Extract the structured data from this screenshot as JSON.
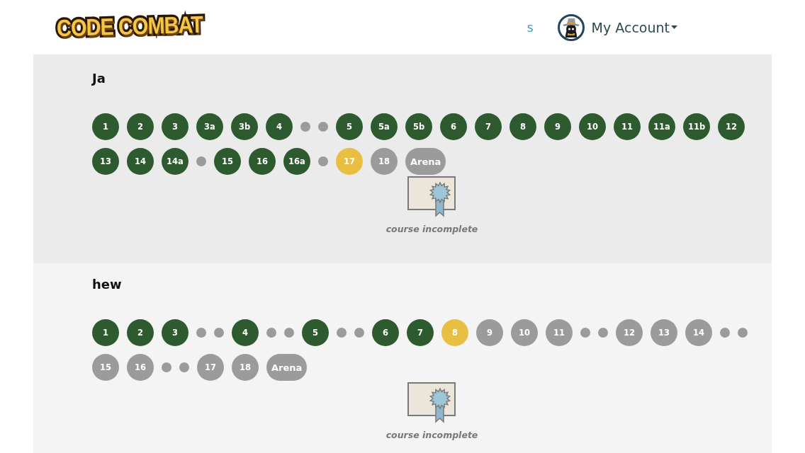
{
  "header": {
    "logo": "CODE COMBAT",
    "nav_links": [
      "s"
    ],
    "account": {
      "label": "My Account"
    }
  },
  "students": [
    {
      "name": "Ja",
      "levels": [
        {
          "kind": "level",
          "label": "1",
          "color": "#2e5a30"
        },
        {
          "kind": "level",
          "label": "2",
          "color": "#2e5a30"
        },
        {
          "kind": "level",
          "label": "3",
          "color": "#2e5a30"
        },
        {
          "kind": "level",
          "label": "3a",
          "color": "#2e5a30"
        },
        {
          "kind": "level",
          "label": "3b",
          "color": "#2e5a30"
        },
        {
          "kind": "level",
          "label": "4",
          "color": "#2e5a30"
        },
        {
          "kind": "dot",
          "color": "#9b9b9b"
        },
        {
          "kind": "dot",
          "color": "#9b9b9b"
        },
        {
          "kind": "level",
          "label": "5",
          "color": "#2e5a30"
        },
        {
          "kind": "level",
          "label": "5a",
          "color": "#2e5a30"
        },
        {
          "kind": "level",
          "label": "5b",
          "color": "#2e5a30"
        },
        {
          "kind": "level",
          "label": "6",
          "color": "#2e5a30"
        },
        {
          "kind": "level",
          "label": "7",
          "color": "#2e5a30"
        },
        {
          "kind": "level",
          "label": "8",
          "color": "#2e5a30"
        },
        {
          "kind": "level",
          "label": "9",
          "color": "#2e5a30"
        },
        {
          "kind": "level",
          "label": "10",
          "color": "#2e5a30"
        },
        {
          "kind": "level",
          "label": "11",
          "color": "#2e5a30"
        },
        {
          "kind": "level",
          "label": "11a",
          "color": "#2e5a30"
        },
        {
          "kind": "level",
          "label": "11b",
          "color": "#2e5a30"
        },
        {
          "kind": "level",
          "label": "12",
          "color": "#2e5a30"
        },
        {
          "kind": "level",
          "label": "13",
          "color": "#2e5a30"
        },
        {
          "kind": "level",
          "label": "14",
          "color": "#2e5a30"
        },
        {
          "kind": "level",
          "label": "14a",
          "color": "#2e5a30"
        },
        {
          "kind": "dot",
          "color": "#9b9b9b"
        },
        {
          "kind": "level",
          "label": "15",
          "color": "#2e5a30"
        },
        {
          "kind": "level",
          "label": "16",
          "color": "#2e5a30"
        },
        {
          "kind": "level",
          "label": "16a",
          "color": "#2e5a30"
        },
        {
          "kind": "dot",
          "color": "#9b9b9b"
        },
        {
          "kind": "level",
          "label": "17",
          "color": "#e9bf43"
        },
        {
          "kind": "level",
          "label": "18",
          "color": "#9b9b9b"
        },
        {
          "kind": "arena",
          "label": "Arena",
          "color": "#9b9b9b"
        }
      ],
      "certificate": {
        "caption": "course incomplete"
      }
    },
    {
      "name": "hew",
      "levels": [
        {
          "kind": "level",
          "label": "1",
          "color": "#2e5a30"
        },
        {
          "kind": "level",
          "label": "2",
          "color": "#2e5a30"
        },
        {
          "kind": "level",
          "label": "3",
          "color": "#2e5a30"
        },
        {
          "kind": "dot",
          "color": "#9b9b9b"
        },
        {
          "kind": "dot",
          "color": "#9b9b9b"
        },
        {
          "kind": "level",
          "label": "4",
          "color": "#2e5a30"
        },
        {
          "kind": "dot",
          "color": "#9b9b9b"
        },
        {
          "kind": "dot",
          "color": "#9b9b9b"
        },
        {
          "kind": "level",
          "label": "5",
          "color": "#2e5a30"
        },
        {
          "kind": "dot",
          "color": "#9b9b9b"
        },
        {
          "kind": "dot",
          "color": "#9b9b9b"
        },
        {
          "kind": "level",
          "label": "6",
          "color": "#2e5a30"
        },
        {
          "kind": "level",
          "label": "7",
          "color": "#2e5a30"
        },
        {
          "kind": "level",
          "label": "8",
          "color": "#e9bf43"
        },
        {
          "kind": "level",
          "label": "9",
          "color": "#9b9b9b"
        },
        {
          "kind": "level",
          "label": "10",
          "color": "#9b9b9b"
        },
        {
          "kind": "level",
          "label": "11",
          "color": "#9b9b9b"
        },
        {
          "kind": "dot",
          "color": "#9b9b9b"
        },
        {
          "kind": "dot",
          "color": "#9b9b9b"
        },
        {
          "kind": "level",
          "label": "12",
          "color": "#9b9b9b"
        },
        {
          "kind": "level",
          "label": "13",
          "color": "#9b9b9b"
        },
        {
          "kind": "level",
          "label": "14",
          "color": "#9b9b9b"
        },
        {
          "kind": "dot",
          "color": "#9b9b9b"
        },
        {
          "kind": "dot",
          "color": "#9b9b9b"
        },
        {
          "kind": "level",
          "label": "15",
          "color": "#9b9b9b"
        },
        {
          "kind": "level",
          "label": "16",
          "color": "#9b9b9b"
        },
        {
          "kind": "dot",
          "color": "#9b9b9b"
        },
        {
          "kind": "dot",
          "color": "#9b9b9b"
        },
        {
          "kind": "level",
          "label": "17",
          "color": "#9b9b9b"
        },
        {
          "kind": "level",
          "label": "18",
          "color": "#9b9b9b"
        },
        {
          "kind": "arena",
          "label": "Arena",
          "color": "#9b9b9b"
        }
      ],
      "certificate": {
        "caption": "course incomplete"
      }
    }
  ]
}
